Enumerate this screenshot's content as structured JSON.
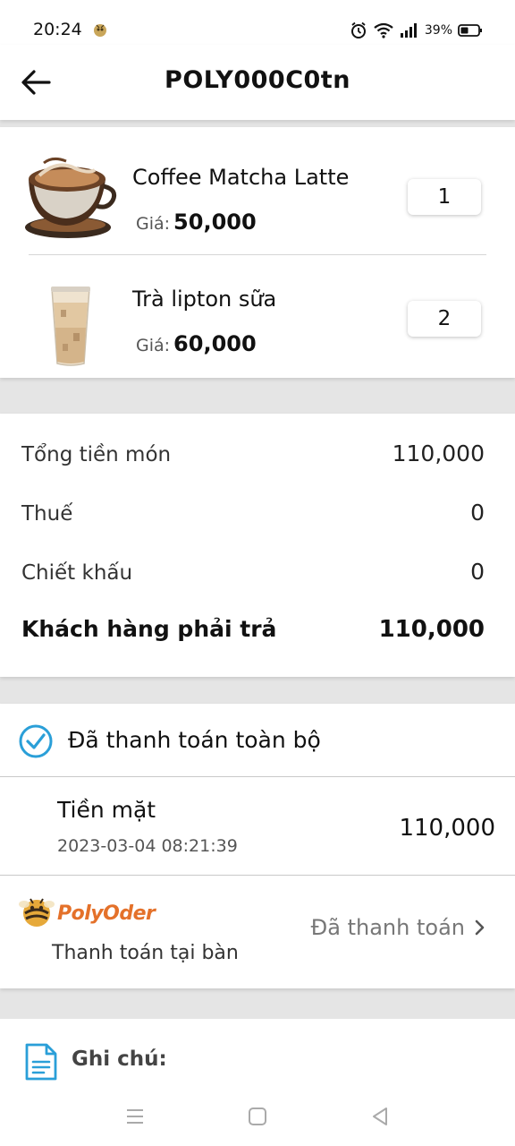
{
  "status_bar": {
    "time": "20:24",
    "battery_percent": "39%",
    "icons": [
      "app-notification-icon",
      "alarm-icon",
      "wifi-icon",
      "signal-icon",
      "battery-icon"
    ]
  },
  "header": {
    "title": "POLY000C0tn",
    "back_icon": "arrow-left-icon"
  },
  "items": [
    {
      "name": "Coffee Matcha Latte",
      "price_label": "Giá:",
      "price": "50,000",
      "quantity": "1",
      "image": "coffee-cup"
    },
    {
      "name": "Trà lipton sữa",
      "price_label": "Giá:",
      "price": "60,000",
      "quantity": "2",
      "image": "milk-tea-cup"
    }
  ],
  "summary": {
    "subtotal_label": "Tổng tiền món",
    "subtotal": "110,000",
    "tax_label": "Thuế",
    "tax": "0",
    "discount_label": "Chiết khấu",
    "discount": "0",
    "total_label": "Khách hàng phải trả",
    "total": "110,000"
  },
  "payment": {
    "status": "Đã thanh toán toàn bộ",
    "method": "Tiền mặt",
    "timestamp": "2023-03-04 08:21:39",
    "amount": "110,000",
    "brand": "PolyOder",
    "pay_location": "Thanh toán tại bàn",
    "pay_status": "Đã thanh toán"
  },
  "note": {
    "label": "Ghi chú:"
  },
  "colors": {
    "accent_blue": "#2a9fd8",
    "brand_orange": "#e4712a",
    "background": "#e5e5e5"
  }
}
